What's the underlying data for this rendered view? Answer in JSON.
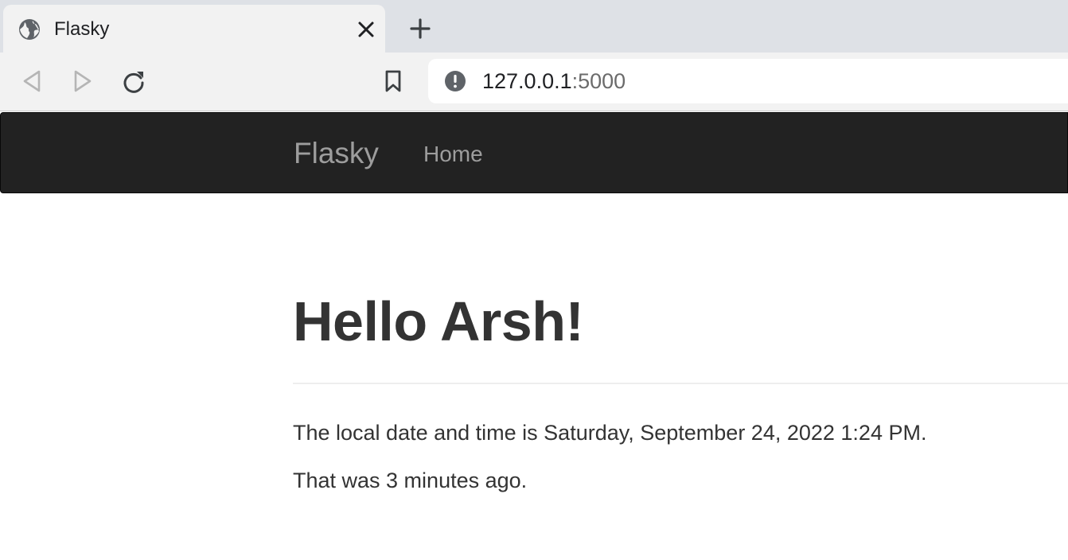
{
  "browser": {
    "tab": {
      "title": "Flasky",
      "favicon": "globe-icon"
    },
    "address": {
      "host": "127.0.0.1",
      "port": ":5000",
      "security_icon": "info-icon"
    }
  },
  "navbar": {
    "brand": "Flasky",
    "links": [
      {
        "label": "Home"
      }
    ]
  },
  "content": {
    "greeting": "Hello Arsh!",
    "datetime_line": "The local date and time is Saturday, September 24, 2022 1:24 PM.",
    "relative_line": "That was 3 minutes ago."
  },
  "colors": {
    "navbar_bg": "#222222",
    "navbar_text": "#9d9d9d",
    "body_text": "#333333"
  }
}
